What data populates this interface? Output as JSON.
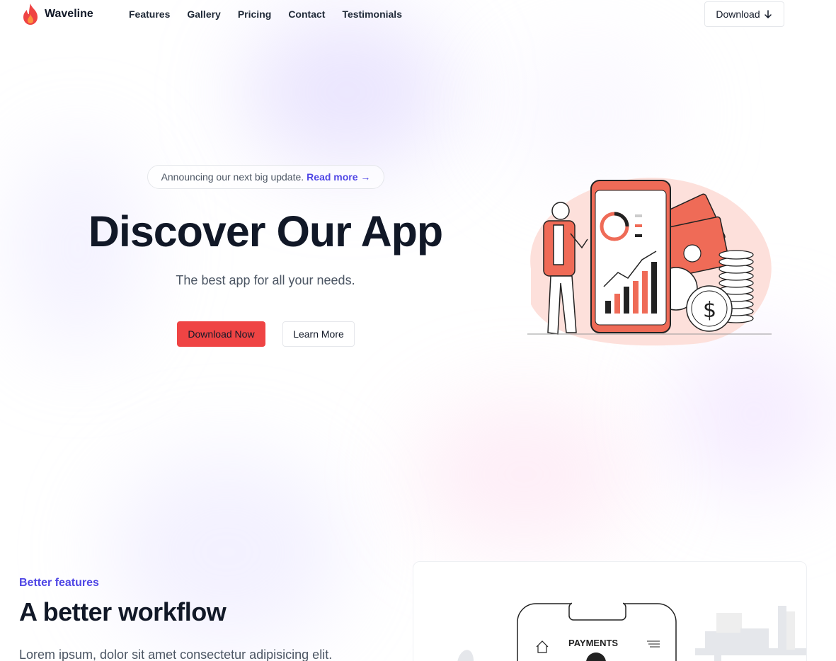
{
  "brand": {
    "name": "Waveline",
    "logo_icon": "flame-icon",
    "accent": "#ef4444"
  },
  "nav": {
    "links": [
      "Features",
      "Gallery",
      "Pricing",
      "Contact",
      "Testimonials"
    ],
    "download_label": "Download",
    "download_icon": "arrow-down-icon"
  },
  "hero": {
    "announcement_text": "Announcing our next big update.",
    "announcement_link": "Read more",
    "announcement_arrow": "→",
    "title": "Discover Our App",
    "subtitle": "The best app for all your needs.",
    "primary_button": "Download Now",
    "secondary_button": "Learn More"
  },
  "features": {
    "eyebrow": "Better features",
    "title": "A better workflow",
    "description": "Lorem ipsum, dolor sit amet consectetur adipisicing elit.",
    "card_label": "PAYMENTS"
  },
  "colors": {
    "primary_button": "#ef4444",
    "link": "#4f46e5",
    "heading": "#111827",
    "body_text": "#4b5563"
  }
}
